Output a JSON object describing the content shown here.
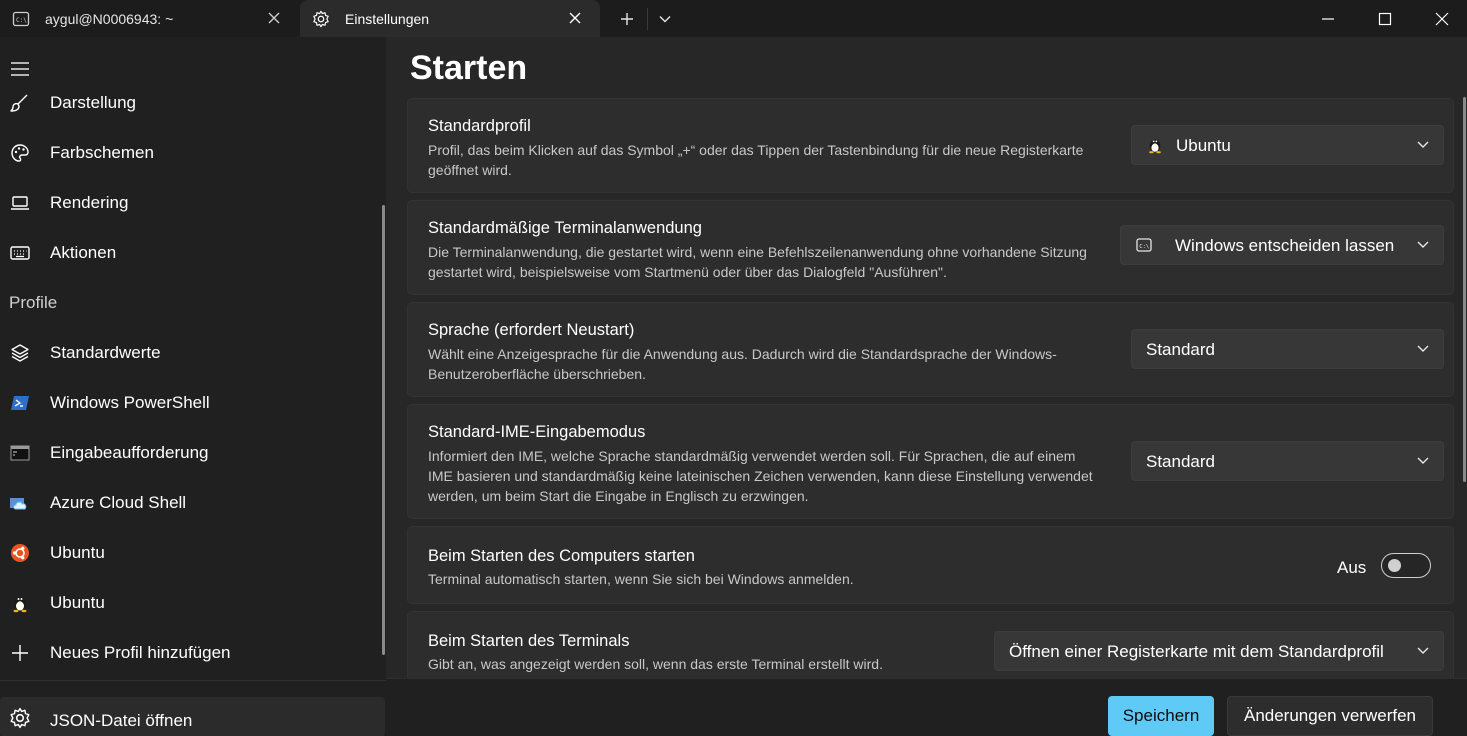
{
  "tabs": [
    {
      "label": "aygul@N0006943: ~",
      "icon": "terminal-icon",
      "active": false
    },
    {
      "label": "Einstellungen",
      "icon": "gear-icon",
      "active": true
    }
  ],
  "sidebar": {
    "items_top": [
      {
        "label": "Darstellung",
        "icon": "brush-icon"
      },
      {
        "label": "Farbschemen",
        "icon": "palette-icon"
      },
      {
        "label": "Rendering",
        "icon": "laptop-icon"
      },
      {
        "label": "Aktionen",
        "icon": "keyboard-icon"
      }
    ],
    "section_label": "Profile",
    "profiles": [
      {
        "label": "Standardwerte",
        "icon": "layers-icon"
      },
      {
        "label": "Windows PowerShell",
        "icon": "powershell-icon"
      },
      {
        "label": "Eingabeaufforderung",
        "icon": "cmd-icon"
      },
      {
        "label": "Azure Cloud Shell",
        "icon": "azure-cloud-icon"
      },
      {
        "label": "Ubuntu",
        "icon": "ubuntu-icon"
      },
      {
        "label": "Ubuntu",
        "icon": "tux-icon"
      },
      {
        "label": "Neues Profil hinzufügen",
        "icon": "plus-icon"
      }
    ],
    "json_label": "JSON-Datei öffnen"
  },
  "main": {
    "title": "Starten",
    "settings": {
      "default_profile": {
        "title": "Standardprofil",
        "desc": "Profil, das beim Klicken auf das Symbol „+“ oder das Tippen der Tastenbindung für die neue Registerkarte geöffnet wird.",
        "value": "Ubuntu"
      },
      "default_terminal": {
        "title": "Standardmäßige Terminalanwendung",
        "desc": "Die Terminalanwendung, die gestartet wird, wenn eine Befehlszeilenanwendung ohne vorhandene Sitzung gestartet wird, beispielsweise vom Startmenü oder über das Dialogfeld \"Ausführen\".",
        "value": "Windows entscheiden lassen"
      },
      "language": {
        "title": "Sprache (erfordert Neustart)",
        "desc": "Wählt eine Anzeigesprache für die Anwendung aus. Dadurch wird die Standardsprache der Windows-Benutzeroberfläche überschrieben.",
        "value": "Standard"
      },
      "ime": {
        "title": "Standard-IME-Eingabemodus",
        "desc": "Informiert den IME, welche Sprache standardmäßig verwendet werden soll. Für Sprachen, die auf einem IME basieren und standardmäßig keine lateinischen Zeichen verwenden, kann diese Einstellung verwendet werden, um beim Start die Eingabe in Englisch zu erzwingen.",
        "value": "Standard"
      },
      "launch_on_startup": {
        "title": "Beim Starten des Computers starten",
        "desc": "Terminal automatisch starten, wenn Sie sich bei Windows anmelden.",
        "toggle_label": "Aus",
        "on": false
      },
      "on_terminal_start": {
        "title": "Beim Starten des Terminals",
        "desc": "Gibt an, was angezeigt werden soll, wenn das erste Terminal erstellt wird.",
        "value": "Öffnen einer Registerkarte mit dem Standardprofil"
      }
    }
  },
  "footer": {
    "save_label": "Speichern",
    "discard_label": "Änderungen verwerfen"
  },
  "colors": {
    "accent": "#5fcaf6",
    "background": "#202020",
    "card": "#2d2d2d"
  }
}
